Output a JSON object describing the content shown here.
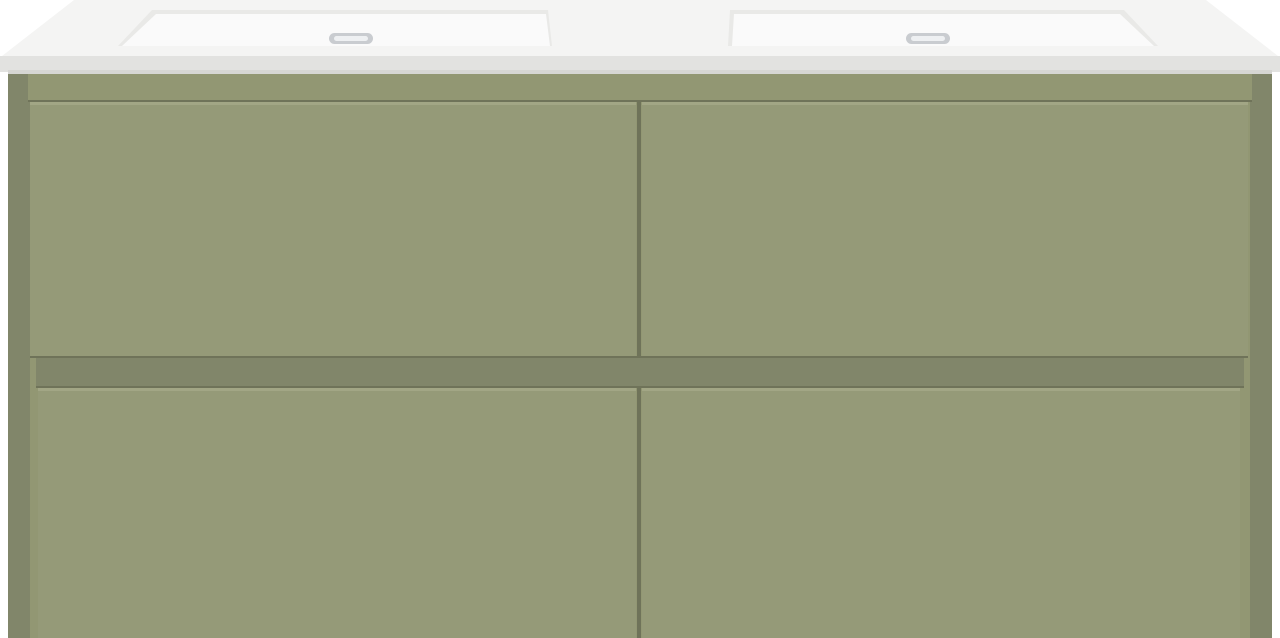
{
  "product": {
    "type": "double-basin-vanity",
    "drawer_count": 4,
    "basin_count": 2,
    "overflow_drain_count": 2
  },
  "colors": {
    "background": "#ffffff",
    "countertop": "#f4f4f3",
    "countertop_edge": "#e2e2e0",
    "countertop_shadow": "#d6d6d3",
    "basin": "#fafafa",
    "basin_shadow": "#e9e9e7",
    "chrome": "#c9ccd0",
    "cabinet": "#929773",
    "cabinet_dark": "#81866a",
    "cabinet_shadow": "#6f7359",
    "drawer_front": "#959a78",
    "drawer_highlight": "#a2a685"
  }
}
